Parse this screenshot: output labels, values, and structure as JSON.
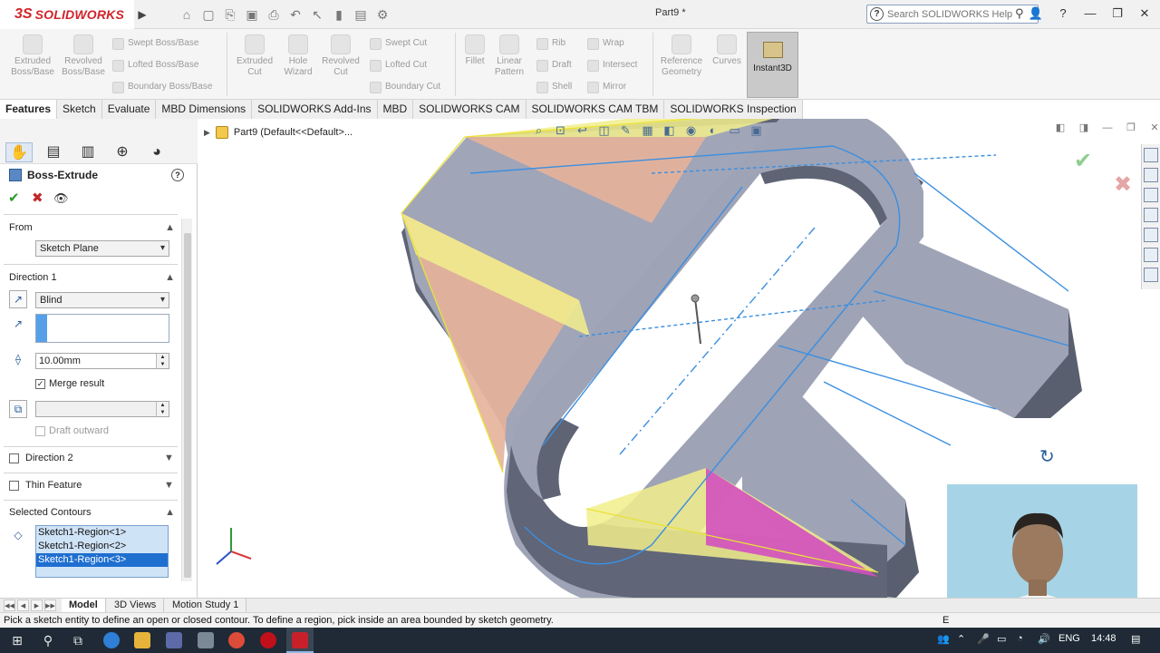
{
  "app": {
    "logo_ds": "3S",
    "logo_name": "SOLIDWORKS",
    "document_title": "Part9 *",
    "search_placeholder": "Search SOLIDWORKS Help",
    "search_help_glyph": "?"
  },
  "command_manager": {
    "large_tools": [
      {
        "label_1": "Extruded",
        "label_2": "Boss/Base"
      },
      {
        "label_1": "Revolved",
        "label_2": "Boss/Base"
      },
      {
        "label_1": "Extruded",
        "label_2": "Cut"
      },
      {
        "label_1": "Hole",
        "label_2": "Wizard"
      },
      {
        "label_1": "Revolved",
        "label_2": "Cut"
      },
      {
        "label_1": "Fillet",
        "label_2": ""
      },
      {
        "label_1": "Linear",
        "label_2": "Pattern"
      },
      {
        "label_1": "Reference",
        "label_2": "Geometry"
      },
      {
        "label_1": "Curves",
        "label_2": ""
      }
    ],
    "small_tools": {
      "swept_boss": "Swept Boss/Base",
      "lofted_boss": "Lofted Boss/Base",
      "boundary_boss": "Boundary Boss/Base",
      "swept_cut": "Swept Cut",
      "lofted_cut": "Lofted Cut",
      "boundary_cut": "Boundary Cut",
      "rib": "Rib",
      "draft": "Draft",
      "shell": "Shell",
      "wrap": "Wrap",
      "intersect": "Intersect",
      "mirror": "Mirror"
    },
    "instant3d": "Instant3D"
  },
  "tabs": [
    "Features",
    "Sketch",
    "Evaluate",
    "MBD Dimensions",
    "SOLIDWORKS Add-Ins",
    "MBD",
    "SOLIDWORKS CAM",
    "SOLIDWORKS CAM TBM",
    "SOLIDWORKS Inspection"
  ],
  "property_manager": {
    "title": "Boss-Extrude",
    "help": "?",
    "from": {
      "header": "From",
      "value": "Sketch Plane"
    },
    "direction1": {
      "header": "Direction 1",
      "end_condition": "Blind",
      "depth": "10.00mm",
      "merge_result": "Merge result",
      "draft_outward": "Draft outward"
    },
    "direction2": "Direction 2",
    "thin_feature": "Thin Feature",
    "selected_contours": {
      "header": "Selected Contours",
      "items": [
        "Sketch1-Region<1>",
        "Sketch1-Region<2>",
        "Sketch1-Region<3>"
      ]
    }
  },
  "graphics": {
    "tree_root": "Part9  (Default<<Default>..."
  },
  "bottom_tabs": [
    "Model",
    "3D Views",
    "Motion Study 1"
  ],
  "status": {
    "message": "Pick a sketch entity to define an open or closed contour. To define a region, pick inside an area bounded by sketch geometry.",
    "right": "E"
  },
  "taskbar": {
    "language": "ENG",
    "time": "14:48"
  },
  "colors": {
    "body_top": "#9ea3b6",
    "body_side": "#5f6475",
    "preview_yellow": "#f2ef8c",
    "preview_salmon": "#e6b39a",
    "preview_magenta": "#d24fbf",
    "sketch_blue": "#3b8fe0"
  }
}
